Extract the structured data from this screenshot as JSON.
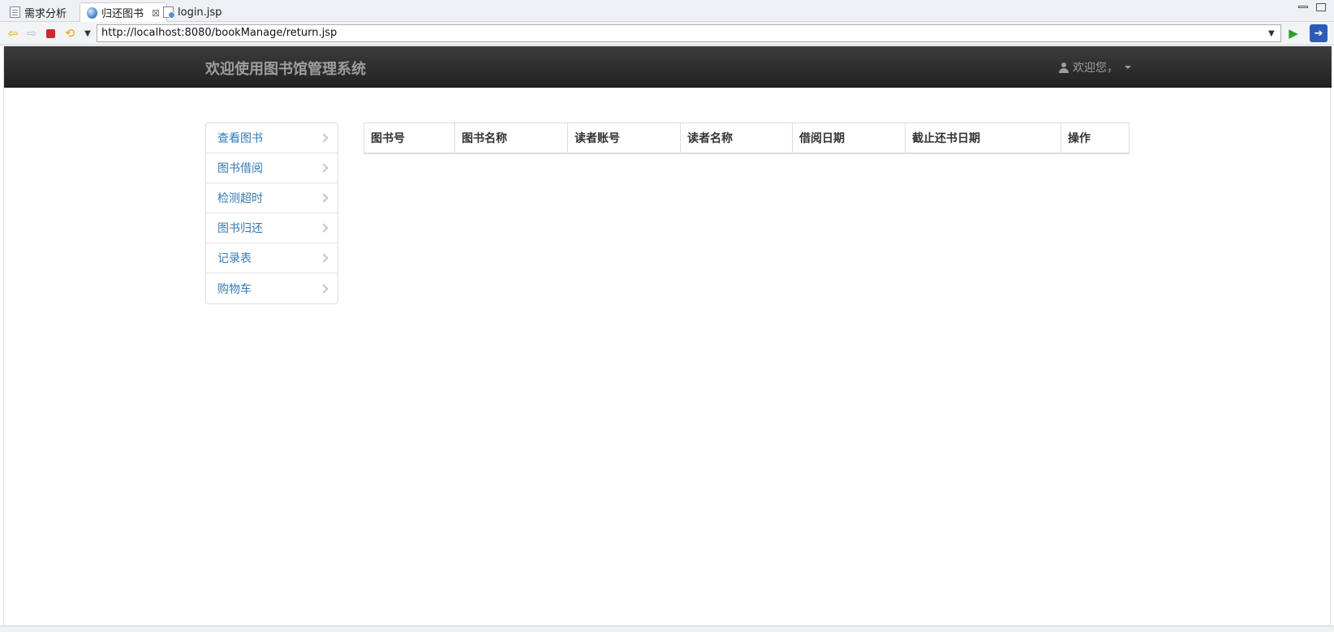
{
  "editor_tabs": [
    {
      "label": "需求分析",
      "icon": "document-icon"
    },
    {
      "label": "归还图书",
      "icon": "globe-icon",
      "close": "⊠"
    },
    {
      "label": "login.jsp",
      "icon": "jsp-file-icon"
    }
  ],
  "browser": {
    "url": "http://localhost:8080/bookManage/return.jsp"
  },
  "navbar": {
    "brand": "欢迎使用图书馆管理系统",
    "user_label": "欢迎您，"
  },
  "sidebar": {
    "items": [
      {
        "label": "查看图书"
      },
      {
        "label": "图书借阅"
      },
      {
        "label": "检测超时"
      },
      {
        "label": "图书归还"
      },
      {
        "label": "记录表"
      },
      {
        "label": "购物车"
      }
    ]
  },
  "table": {
    "headers": [
      "图书号",
      "图书名称",
      "读者账号",
      "读者名称",
      "借阅日期",
      "截止还书日期",
      "操作"
    ]
  },
  "colors": {
    "navbar_bg": "#222222",
    "brand_text": "#9d9d9d",
    "link": "#337ab7"
  }
}
